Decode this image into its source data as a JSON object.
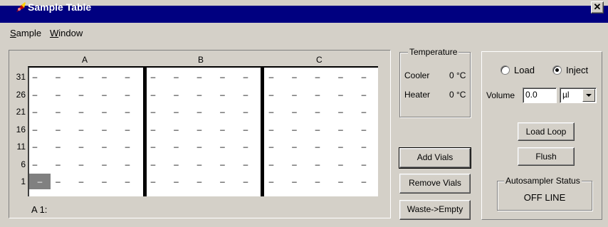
{
  "window": {
    "title": "Sample Table",
    "close_glyph": "✕"
  },
  "menu": [
    {
      "label_first": "S",
      "label_rest": "ample"
    },
    {
      "label_first": "W",
      "label_rest": "indow"
    }
  ],
  "tray": {
    "columns": [
      "A",
      "B",
      "C"
    ],
    "rows": [
      "31",
      "26",
      "21",
      "16",
      "11",
      "6",
      "1"
    ],
    "cell_value": "–",
    "selected_cell": "A 1",
    "status": "A 1:"
  },
  "temperature": {
    "title": "Temperature",
    "cooler_label": "Cooler",
    "cooler_value": "0 °C",
    "heater_label": "Heater",
    "heater_value": "0 °C"
  },
  "vial_buttons": {
    "add": "Add Vials",
    "remove": "Remove Vials",
    "waste": "Waste->Empty"
  },
  "injector": {
    "load_label": "Load",
    "inject_label": "Inject",
    "selected_mode": "Inject",
    "volume_label": "Volume",
    "volume_value": "0.0",
    "unit_value": "µl",
    "load_loop": "Load Loop",
    "flush": "Flush"
  },
  "autosampler": {
    "title": "Autosampler Status",
    "status": "OFF LINE"
  }
}
